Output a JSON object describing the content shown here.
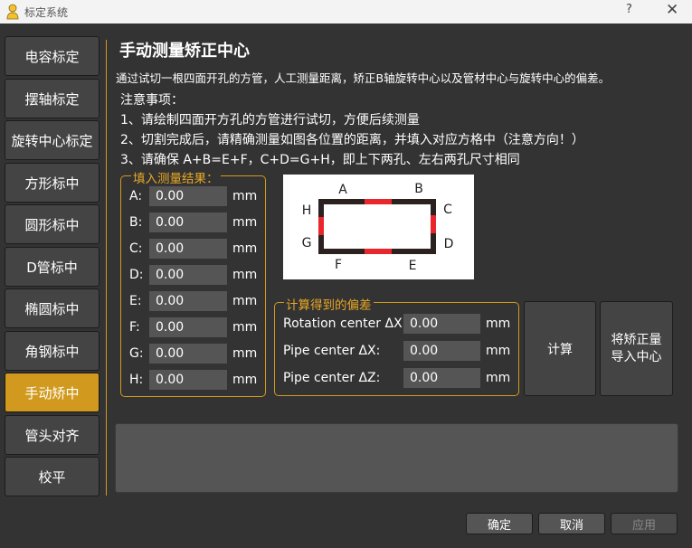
{
  "window": {
    "title": "标定系统",
    "help": "?",
    "close": "✕"
  },
  "nav": [
    {
      "label": "电容标定"
    },
    {
      "label": "摆轴标定"
    },
    {
      "label": "旋转中心标定"
    },
    {
      "label": "方形标中"
    },
    {
      "label": "圆形标中"
    },
    {
      "label": "D管标中"
    },
    {
      "label": "椭圆标中"
    },
    {
      "label": "角钢标中"
    },
    {
      "label": "手动矫中"
    },
    {
      "label": "管头对齐"
    },
    {
      "label": "校平"
    }
  ],
  "active_nav": "手动矫中",
  "main": {
    "heading": "手动测量矫正中心",
    "description": "通过试切一根四面开孔的方管，人工测量距离，矫正B轴旋转中心以及管材中心与旋转中心的偏差。",
    "notes_title": "注意事项：",
    "notes": [
      "1、请绘制四面开方孔的方管进行试切，方便后续测量",
      "2、切割完成后，请精确测量如图各位置的距离，并填入对应方格中（注意方向！）",
      "3、请确保 A+B=E+F，C+D=G+H，即上下两孔、左右两孔尺寸相同"
    ]
  },
  "measure": {
    "title": "填入测量结果：",
    "unit": "mm",
    "rows": [
      {
        "label": "A:",
        "value": "0.00"
      },
      {
        "label": "B:",
        "value": "0.00"
      },
      {
        "label": "C:",
        "value": "0.00"
      },
      {
        "label": "D:",
        "value": "0.00"
      },
      {
        "label": "E:",
        "value": "0.00"
      },
      {
        "label": "F:",
        "value": "0.00"
      },
      {
        "label": "G:",
        "value": "0.00"
      },
      {
        "label": "H:",
        "value": "0.00"
      }
    ]
  },
  "diagram": {
    "labels": {
      "A": "A",
      "B": "B",
      "C": "C",
      "D": "D",
      "E": "E",
      "F": "F",
      "G": "G",
      "H": "H"
    },
    "frame_color": "#2b2220",
    "hole_color": "#e8262c"
  },
  "calc": {
    "title": "计算得到的偏差",
    "unit": "mm",
    "rows": [
      {
        "label": "Rotation center ΔX:",
        "value": "0.00"
      },
      {
        "label": "Pipe center ΔX:",
        "value": "0.00"
      },
      {
        "label": "Pipe center ΔZ:",
        "value": "0.00"
      }
    ]
  },
  "buttons": {
    "compute": "计算",
    "import_line1": "将矫正量",
    "import_line2": "导入中心",
    "ok": "确定",
    "cancel": "取消",
    "apply": "应用"
  },
  "colors": {
    "accent": "#d19a1e",
    "background": "#333333",
    "field": "#555555"
  }
}
